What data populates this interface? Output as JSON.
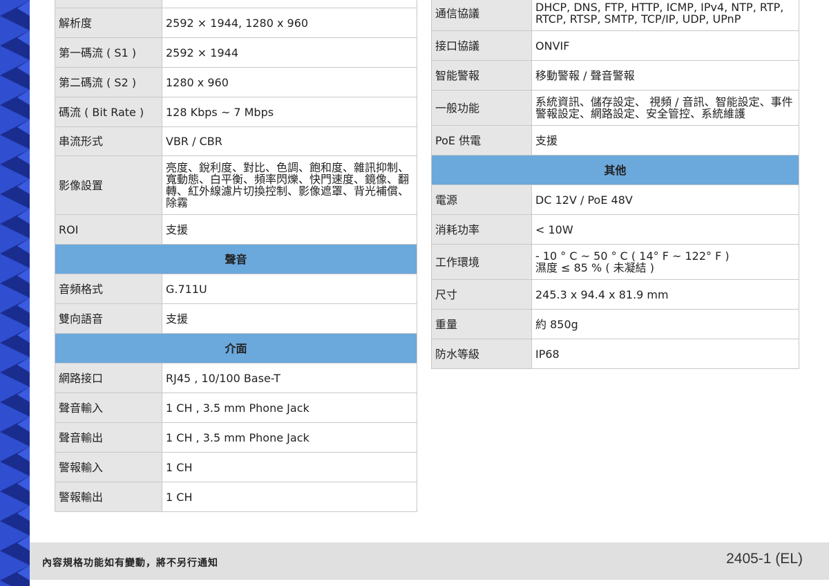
{
  "left_table": [
    {
      "label": "",
      "value": ""
    },
    {
      "label": "解析度",
      "value": "2592 × 1944, 1280 x 960"
    },
    {
      "label": "第一碼流 ( S1 )",
      "value": "2592 × 1944"
    },
    {
      "label": "第二碼流 ( S2 )",
      "value": "1280 x 960"
    },
    {
      "label": "碼流 ( Bit Rate )",
      "value": "128 Kbps ~ 7 Mbps"
    },
    {
      "label": "串流形式",
      "value": "VBR / CBR"
    },
    {
      "label": "影像設置",
      "value": "亮度、銳利度、對比、色調、飽和度、雜訊抑制、寬動態、白平衡、頻率閃爍、快門速度、鏡像、翻轉、紅外線濾片切換控制、影像遮罩、背光補償、除霧"
    },
    {
      "label": "ROI",
      "value": "支援"
    },
    {
      "section": "聲音"
    },
    {
      "label": "音頻格式",
      "value": "G.711U"
    },
    {
      "label": "雙向語音",
      "value": "支援"
    },
    {
      "section": "介面"
    },
    {
      "label": "網路接口",
      "value": "RJ45 , 10/100 Base-T"
    },
    {
      "label": "聲音輸入",
      "value": "1 CH , 3.5 mm Phone Jack"
    },
    {
      "label": "聲音輸出",
      "value": "1 CH , 3.5 mm Phone Jack"
    },
    {
      "label": "警報輸入",
      "value": "1 CH"
    },
    {
      "label": "警報輸出",
      "value": "1 CH"
    }
  ],
  "right_table": [
    {
      "label": "通信協議",
      "value": "DHCP, DNS, FTP, HTTP, ICMP, IPv4, NTP, RTP, RTCP, RTSP, SMTP, TCP/IP, UDP, UPnP"
    },
    {
      "label": "接口協議",
      "value": "ONVIF"
    },
    {
      "label": "智能警報",
      "value": "移動警報 / 聲音警報"
    },
    {
      "label": "一般功能",
      "value": "系統資訊、儲存設定、 視頻 / 音訊、智能設定、事件警報設定、網路設定、安全管控、系統維護"
    },
    {
      "label": "PoE 供電",
      "value": "支援"
    },
    {
      "section": "其他"
    },
    {
      "label": "電源",
      "value": "DC 12V / PoE 48V"
    },
    {
      "label": "消耗功率",
      "value": "< 10W"
    },
    {
      "label": "工作環境",
      "value": "- 10 ° C ~ 50 ° C ( 14° F ~ 122° F )\n濕度 ≤  85 % ( 未凝結 )"
    },
    {
      "label": "尺寸",
      "value": "245.3 x 94.4 x 81.9 mm"
    },
    {
      "label": "重量",
      "value": "約 850g"
    },
    {
      "label": "防水等級",
      "value": "IP68"
    }
  ],
  "footer": {
    "note": "內容規格功能如有變動，將不另行通知",
    "doc_code": "2405-1 (EL)"
  },
  "colors": {
    "section_header": "#6ba8dc",
    "label_cell": "#e6e6e6",
    "stripe_dark": "#1a2d8f",
    "stripe_light": "#2f4fd0"
  }
}
